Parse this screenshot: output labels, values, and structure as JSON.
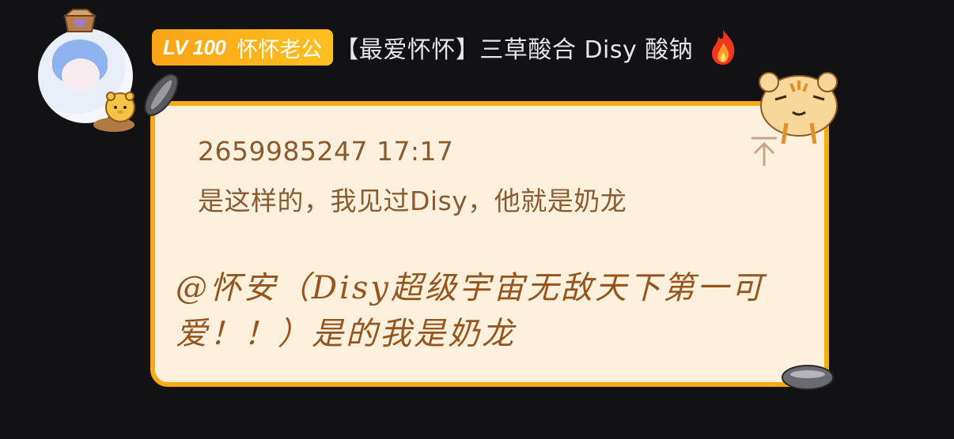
{
  "user": {
    "avatar_icon": "anime-avatar-icon",
    "level_label": "LV 100",
    "nickname": "怀怀老公",
    "title": "【最爱怀怀】三草酸合 Disy 酸钠",
    "flame_icon": "fire-icon",
    "badge_color": "#f9a416"
  },
  "bubble": {
    "border_color": "#f8a915",
    "background": "#fdf1dd",
    "quote": {
      "meta": "2659985247 17:17",
      "text": "是这样的，我见过Disy，他就是奶龙",
      "pin_icon": "pin-top-icon"
    },
    "reply": "@怀安（Disy超级宇宙无敌天下第一可爱！！）是的我是奶龙"
  }
}
